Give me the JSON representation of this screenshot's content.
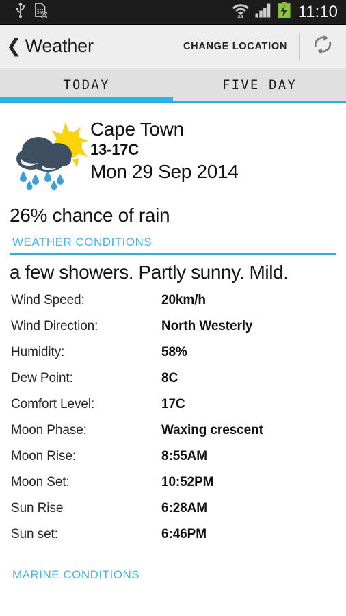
{
  "statusbar": {
    "time": "11:10",
    "icons": [
      "usb-icon",
      "no-sim-icon",
      "wifi-icon",
      "signal-icon",
      "battery-charging-icon"
    ]
  },
  "actionbar": {
    "back_icon": "back-chevron-icon",
    "title": "Weather",
    "change_location_label": "CHANGE LOCATION",
    "refresh_icon": "refresh-icon"
  },
  "tabs": {
    "items": [
      {
        "label": "TODAY",
        "active": true
      },
      {
        "label": "FIVE DAY",
        "active": false
      }
    ],
    "accent_color": "#29b6e8"
  },
  "today": {
    "weather_icon": "rain-sun-cloud-icon",
    "city": "Cape Town",
    "temp_range": "13-17C",
    "date": "Mon 29 Sep 2014",
    "rain_chance": "26% chance of rain",
    "weather_conditions_header": "WEATHER CONDITIONS",
    "condition_description": "a few showers. Partly sunny. Mild.",
    "details": [
      {
        "label": "Wind Speed:",
        "value": "20km/h"
      },
      {
        "label": "Wind Direction:",
        "value": "North Westerly"
      },
      {
        "label": "Humidity:",
        "value": "58%"
      },
      {
        "label": "Dew Point:",
        "value": "8C"
      },
      {
        "label": "Comfort Level:",
        "value": "17C"
      },
      {
        "label": "Moon Phase:",
        "value": "Waxing crescent"
      },
      {
        "label": "Moon Rise:",
        "value": "8:55AM"
      },
      {
        "label": "Moon Set:",
        "value": "10:52PM"
      },
      {
        "label": "Sun Rise",
        "value": "6:28AM"
      },
      {
        "label": "Sun set:",
        "value": "6:46PM"
      }
    ],
    "marine_conditions_header": "MARINE CONDITIONS"
  },
  "colors": {
    "accent": "#29b6e8",
    "section_header": "#4cb3e4",
    "statusbar_bg": "#1c1c1c",
    "actionbar_bg": "#eeeeee",
    "tabbar_bg": "#e0e0e0",
    "battery_green": "#8cc63f"
  }
}
